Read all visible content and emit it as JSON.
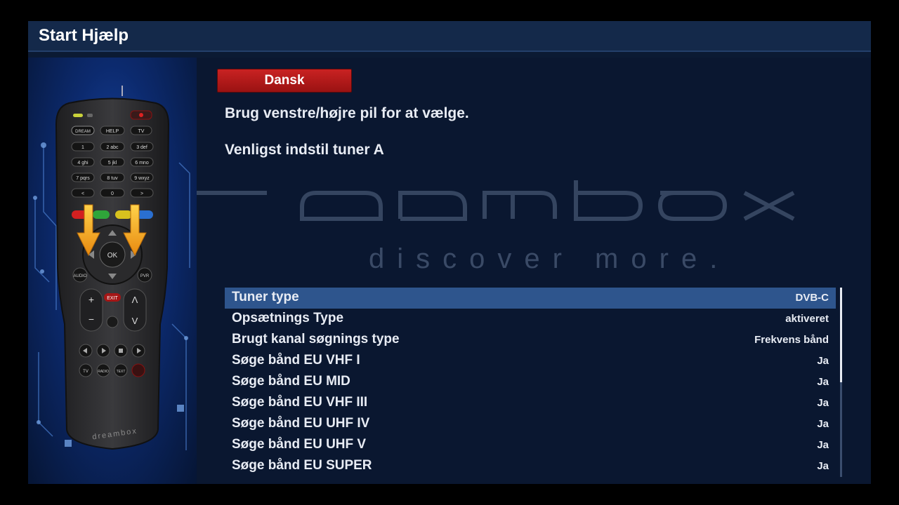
{
  "title": "Start Hjælp",
  "language": "Dansk",
  "instruction": "Brug venstre/højre pil for at vælge.",
  "tuner_prompt": "Venligst indstil tuner A",
  "watermark": {
    "tagline": "discover more."
  },
  "settings": [
    {
      "label": "Tuner type",
      "value": "DVB-C"
    },
    {
      "label": "Opsætnings Type",
      "value": "aktiveret"
    },
    {
      "label": "Brugt kanal søgnings type",
      "value": "Frekvens bånd"
    },
    {
      "label": "Søge bånd EU VHF I",
      "value": "Ja"
    },
    {
      "label": "Søge bånd EU MID",
      "value": "Ja"
    },
    {
      "label": "Søge bånd EU VHF III",
      "value": "Ja"
    },
    {
      "label": "Søge bånd EU UHF IV",
      "value": "Ja"
    },
    {
      "label": "Søge bånd EU UHF V",
      "value": "Ja"
    },
    {
      "label": "Søge bånd EU SUPER",
      "value": "Ja"
    }
  ],
  "remote": {
    "top_buttons": [
      "DREAM",
      "HELP",
      "TV"
    ],
    "keypad": [
      [
        "1",
        "2 abc",
        "3 def"
      ],
      [
        "4 ghi",
        "5 jkl",
        "6 mno"
      ],
      [
        "7 pqrs",
        "8 tuv",
        "9 wxyz"
      ],
      [
        "<",
        "0",
        ">"
      ]
    ],
    "ok": "OK",
    "audio": "AUDIO",
    "pvr": "PVR",
    "exit": "EXIT",
    "plus": "+",
    "minus": "−",
    "up": "Λ",
    "down": "V",
    "bottom_buttons": [
      "TV",
      "RADIO",
      "TEXT"
    ],
    "brand": "dreambox"
  },
  "colors": {
    "selected_row": "#2e558d",
    "language_button": "#b31a1a",
    "background": "#0b1a33",
    "arrow": "#f2a81d"
  }
}
